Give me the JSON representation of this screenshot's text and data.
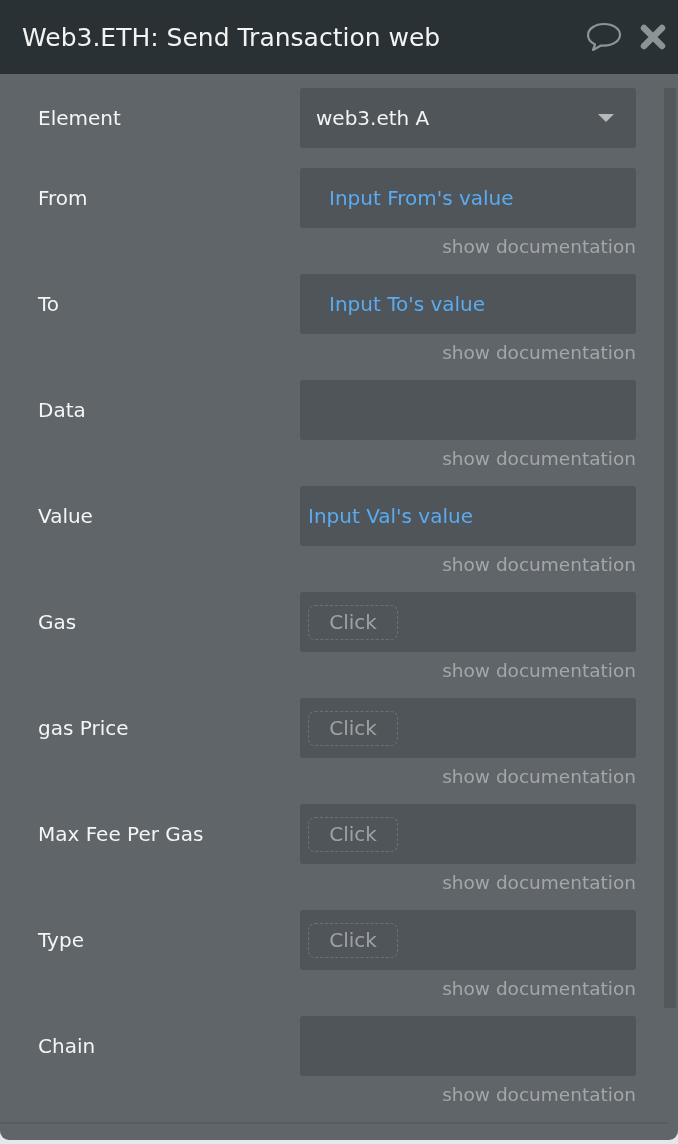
{
  "window": {
    "title": "Web3.ETH: Send Transaction web"
  },
  "fields": [
    {
      "label": "Element",
      "kind": "dropdown",
      "value": "web3.eth A"
    },
    {
      "label": "From",
      "kind": "expression",
      "indented": true,
      "value": "Input From's value",
      "doc_link": "show documentation"
    },
    {
      "label": "To",
      "kind": "expression",
      "indented": true,
      "value": "Input To's value",
      "doc_link": "show documentation"
    },
    {
      "label": "Data",
      "kind": "empty",
      "doc_link": "show documentation"
    },
    {
      "label": "Value",
      "kind": "expression",
      "indented": false,
      "value": "Input Val's value",
      "doc_link": "show documentation"
    },
    {
      "label": "Gas",
      "kind": "click",
      "button": "Click",
      "doc_link": "show documentation"
    },
    {
      "label": "gas Price",
      "kind": "click",
      "button": "Click",
      "doc_link": "show documentation"
    },
    {
      "label": "Max Fee Per Gas",
      "kind": "click",
      "button": "Click",
      "doc_link": "show documentation"
    },
    {
      "label": "Type",
      "kind": "click",
      "button": "Click",
      "doc_link": "show documentation"
    },
    {
      "label": "Chain",
      "kind": "empty",
      "doc_link": "show documentation"
    }
  ]
}
